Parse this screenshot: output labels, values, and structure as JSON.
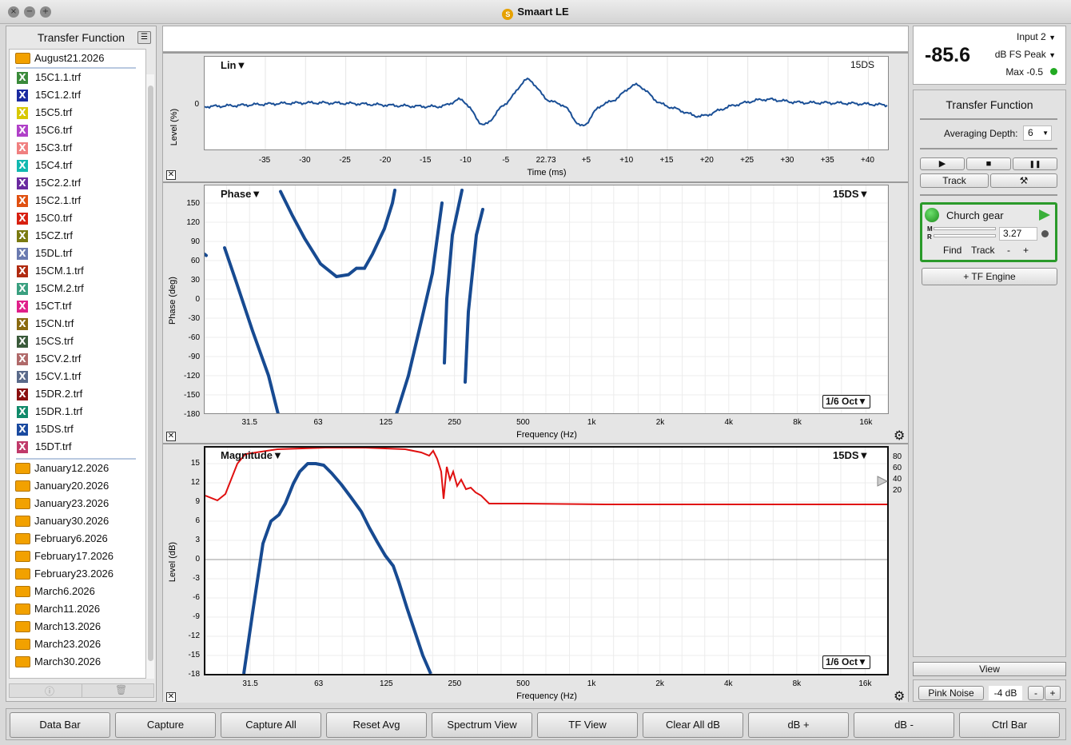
{
  "window": {
    "title": "Smaart LE"
  },
  "sidebar": {
    "title": "Transfer Function",
    "current_folder": "August21.2026",
    "files": [
      {
        "name": "15C1.1.trf",
        "color": "#3a8a3a"
      },
      {
        "name": "15C1.2.trf",
        "color": "#1a2aa0"
      },
      {
        "name": "15C5.trf",
        "color": "#d8c800"
      },
      {
        "name": "15C6.trf",
        "color": "#b040c8"
      },
      {
        "name": "15C3.trf",
        "color": "#f08080"
      },
      {
        "name": "15C4.trf",
        "color": "#10b8b0"
      },
      {
        "name": "15C2.2.trf",
        "color": "#6a2aa0"
      },
      {
        "name": "15C2.1.trf",
        "color": "#e05010"
      },
      {
        "name": "15C0.trf",
        "color": "#d82010"
      },
      {
        "name": "15CZ.trf",
        "color": "#7a7a10"
      },
      {
        "name": "15DL.trf",
        "color": "#6a7ab0"
      },
      {
        "name": "15CM.1.trf",
        "color": "#b02a10"
      },
      {
        "name": "15CM.2.trf",
        "color": "#3aa080"
      },
      {
        "name": "15CT.trf",
        "color": "#e0208a"
      },
      {
        "name": "15CN.trf",
        "color": "#8a6a10"
      },
      {
        "name": "15CS.trf",
        "color": "#3a5a3a"
      },
      {
        "name": "15CV.2.trf",
        "color": "#b06a6a"
      },
      {
        "name": "15CV.1.trf",
        "color": "#5a6a8a"
      },
      {
        "name": "15DR.2.trf",
        "color": "#8a1010"
      },
      {
        "name": "15DR.1.trf",
        "color": "#108a6a"
      },
      {
        "name": "15DS.trf",
        "color": "#1a4aa0"
      },
      {
        "name": "15DT.trf",
        "color": "#c03a6a"
      }
    ],
    "folders": [
      "January12.2026",
      "January20.2026",
      "January23.2026",
      "January30.2026",
      "February6.2026",
      "February17.2026",
      "February23.2026",
      "March6.2026",
      "March11.2026",
      "March13.2026",
      "March23.2026",
      "March30.2026"
    ]
  },
  "impulse": {
    "label": "Lin▼",
    "trace": "15DS",
    "ylabel": "Level (%)",
    "xlabel": "Time (ms)",
    "y0": "0",
    "ticks": [
      "-35",
      "-30",
      "-25",
      "-20",
      "-15",
      "-10",
      "-5",
      "22.73",
      "+5",
      "+10",
      "+15",
      "+20",
      "+25",
      "+30",
      "+35",
      "+40"
    ]
  },
  "phase": {
    "label": "Phase▼",
    "trace": "15DS▼",
    "ylabel": "Phase (deg)",
    "xlabel": "Frequency (Hz)",
    "oct": "1/6 Oct▼",
    "yticks": [
      "150",
      "120",
      "90",
      "60",
      "30",
      "0",
      "-30",
      "-60",
      "-90",
      "-120",
      "-150",
      "-180"
    ],
    "xticks": [
      "31.5",
      "63",
      "125",
      "250",
      "500",
      "1k",
      "2k",
      "4k",
      "8k",
      "16k"
    ]
  },
  "magnitude": {
    "label": "Magnitude▼",
    "trace": "15DS▼",
    "ylabel": "Level (dB)",
    "xlabel": "Frequency (Hz)",
    "oct": "1/6 Oct▼",
    "yticks": [
      "15",
      "12",
      "9",
      "6",
      "3",
      "0",
      "-3",
      "-6",
      "-9",
      "-12",
      "-15",
      "-18"
    ],
    "coh_ticks": [
      "80",
      "60",
      "40",
      "20"
    ],
    "xticks": [
      "31.5",
      "63",
      "125",
      "250",
      "500",
      "1k",
      "2k",
      "4k",
      "8k",
      "16k"
    ]
  },
  "meter": {
    "input": "Input 2",
    "value": "-85.6",
    "mode": "dB FS Peak",
    "max": "Max -0.5",
    "status_color": "#22aa22"
  },
  "tf": {
    "title": "Transfer Function",
    "avg_label": "Averaging Depth:",
    "avg_value": "6",
    "play": "▶",
    "stop": "■",
    "pause": "❚❚",
    "track": "Track",
    "tools": "⚒",
    "engine": {
      "name": "Church gear",
      "delay": "3.27",
      "m": "M",
      "r": "R",
      "find": "Find",
      "track": "Track",
      "minus": "-",
      "plus": "+"
    },
    "add_engine": "+ TF Engine",
    "view": "View",
    "pink": "Pink Noise",
    "pink_level": "-4 dB",
    "minus": "-",
    "plus": "+"
  },
  "bottom_buttons": [
    "Data Bar",
    "Capture",
    "Capture All",
    "Reset Avg",
    "Spectrum View",
    "TF View",
    "Clear All dB",
    "dB +",
    "dB -",
    "Ctrl Bar"
  ]
}
